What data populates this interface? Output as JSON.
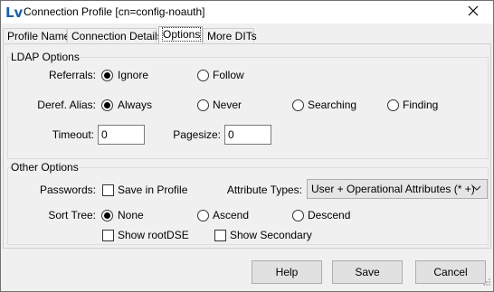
{
  "window": {
    "title": "Connection Profile [cn=config-noauth]",
    "app_icon": "ldap-browser-logo-icon",
    "app_icon_text": "Lv",
    "close_icon": "close-icon"
  },
  "tabs": [
    {
      "label": "Profile Name"
    },
    {
      "label": "Connection Details"
    },
    {
      "label": "Options",
      "active": true
    },
    {
      "label": "More DITs"
    }
  ],
  "ldap_options": {
    "legend": "LDAP Options",
    "referrals": {
      "label": "Referrals:",
      "options": [
        "Ignore",
        "Follow"
      ],
      "selected": "Ignore"
    },
    "deref_alias": {
      "label": "Deref. Alias:",
      "options": [
        "Always",
        "Never",
        "Searching",
        "Finding"
      ],
      "selected": "Always"
    },
    "timeout": {
      "label": "Timeout:",
      "value": "0"
    },
    "pagesize": {
      "label": "Pagesize:",
      "value": "0"
    }
  },
  "other_options": {
    "legend": "Other Options",
    "passwords": {
      "label": "Passwords:",
      "checkbox_label": "Save in Profile",
      "checked": false
    },
    "attribute_types": {
      "label": "Attribute Types:",
      "selected": "User + Operational Attributes (* +)"
    },
    "sort_tree": {
      "label": "Sort Tree:",
      "options": [
        "None",
        "Ascend",
        "Descend"
      ],
      "selected": "None"
    },
    "show_root_dse": {
      "label": "Show rootDSE",
      "checked": false
    },
    "show_secondary": {
      "label": "Show Secondary",
      "checked": false
    }
  },
  "buttons": {
    "help": "Help",
    "save": "Save",
    "cancel": "Cancel"
  },
  "colors": {
    "app_icon_blue": "#1f5fa8",
    "window_bg": "#f0f0f0",
    "border": "#707070"
  }
}
